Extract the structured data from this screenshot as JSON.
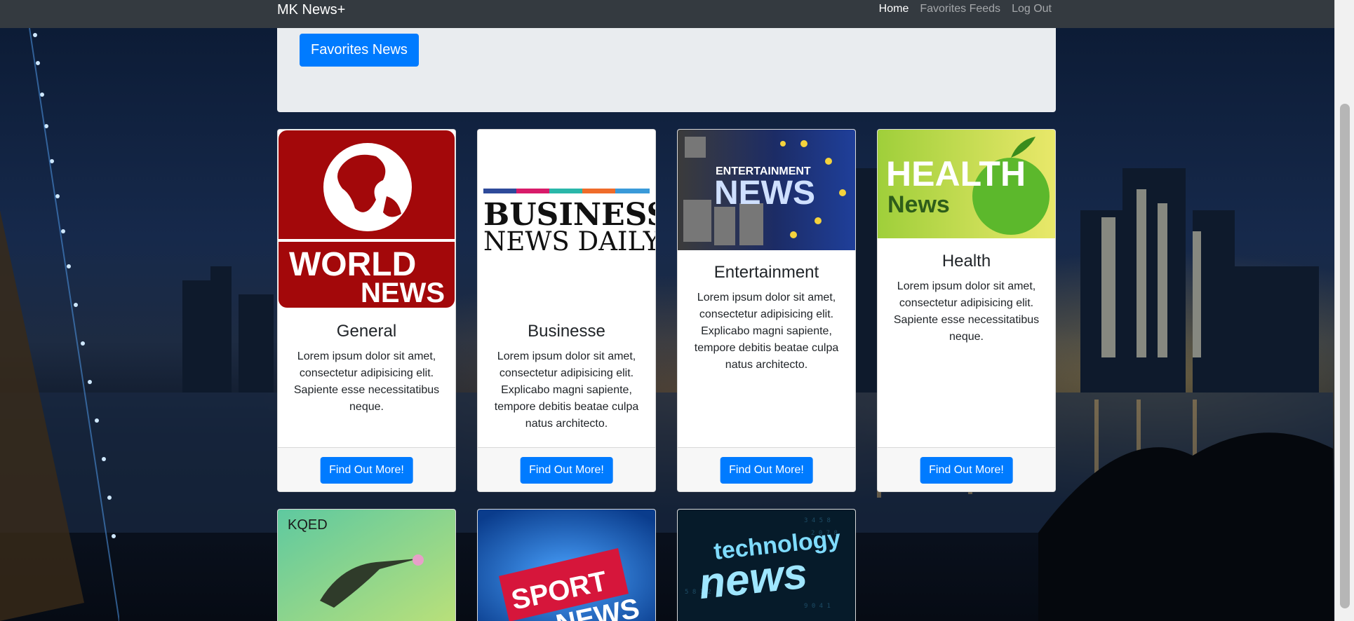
{
  "navbar": {
    "brand": "MK News+",
    "links": [
      "Home",
      "Favorites Feeds",
      "Log Out"
    ]
  },
  "jumbotron": {
    "button_label": "Favorites News"
  },
  "cards": [
    {
      "title": "General",
      "text": "Lorem ipsum dolor sit amet, consectetur adipisicing elit. Sapiente esse necessitatibus neque.",
      "button": "Find Out More!",
      "image_lines": [
        "WORLD",
        "NEWS"
      ]
    },
    {
      "title": "Businesse",
      "text": "Lorem ipsum dolor sit amet, consectetur adipisicing elit. Explicabo magni sapiente, tempore debitis beatae culpa natus architecto.",
      "button": "Find Out More!",
      "image_lines": [
        "BUSINESS",
        "NEWS DAILY"
      ]
    },
    {
      "title": "Entertainment",
      "text": "Lorem ipsum dolor sit amet, consectetur adipisicing elit. Explicabo magni sapiente, tempore debitis beatae culpa natus architecto.",
      "button": "Find Out More!",
      "image_lines": [
        "ENTERTAINMENT",
        "NEWS"
      ]
    },
    {
      "title": "Health",
      "text": "Lorem ipsum dolor sit amet, consectetur adipisicing elit. Sapiente esse necessitatibus neque.",
      "button": "Find Out More!",
      "image_lines": [
        "HEALTH",
        "News"
      ]
    }
  ],
  "bottom_cards": [
    {
      "image_lines": [
        "KQED"
      ]
    },
    {
      "image_lines": [
        "SPORT",
        "NEWS"
      ]
    },
    {
      "image_lines": [
        "technology",
        "news"
      ]
    }
  ],
  "colors": {
    "navbar": "#343a40",
    "primary": "#007bff",
    "jumbotron": "#e9ecef"
  }
}
